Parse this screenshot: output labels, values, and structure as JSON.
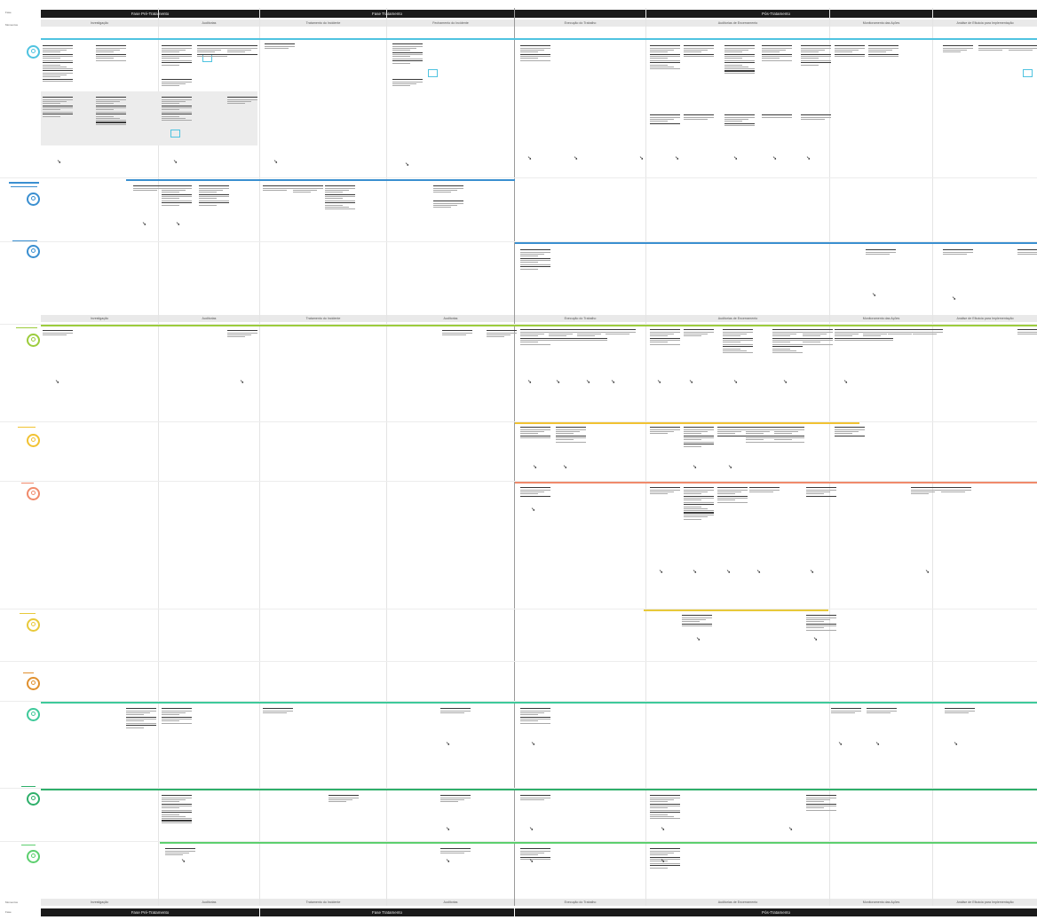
{
  "corner_labels": {
    "top_row": "Fase",
    "second_row": "Momentos",
    "bottom_row_1": "Momentos",
    "bottom_row_2": "Fase"
  },
  "phases_top": [
    "Fase Pré-Tratamento",
    "Fase Tratamento",
    "Pós-Tratamento"
  ],
  "stages_top": [
    "Investigação",
    "Auditorias",
    "Tratamento do Incidente",
    "Fechamento do Incidente",
    "Execução do Trabalho",
    "Auditorias de Encerramento",
    "Monitoramento das Ações",
    "Análise de Eficácia para Implementação"
  ],
  "stages_mid": [
    "Investigação",
    "Auditorias",
    "Tratamento do Incidente",
    "Auditorias",
    "Execução do Trabalho",
    "Auditorias de Encerramento",
    "Monitoramento das Ações",
    "Análise de Eficácia para Implementação"
  ],
  "stages_bottom": [
    "Investigação",
    "Auditorias",
    "Tratamento do Incidente",
    "Auditorias",
    "Execução do Trabalho",
    "Auditorias de Encerramento",
    "Monitoramento das Ações",
    "Análise de Eficácia para Implementação"
  ],
  "phases_bottom": [
    "Fase Pré-Tratamento",
    "Fase Tratamento",
    "Pós-Tratamento"
  ],
  "lane_colors": {
    "lane1": "#4fc3e0",
    "lane2": "#3a8fd0",
    "lane3": "#3a8fd0",
    "lane4": "#9ccc3c",
    "lane5": "#f1c232",
    "lane6": "#f08a6b",
    "lane7": "#e8c93a",
    "lane8": "#e0902f",
    "lane9": "#3ec99a",
    "lane10": "#2eaf6a",
    "lane11": "#5ccf6e"
  },
  "icons": [
    "person-icon",
    "arrow-cursor-icon"
  ]
}
